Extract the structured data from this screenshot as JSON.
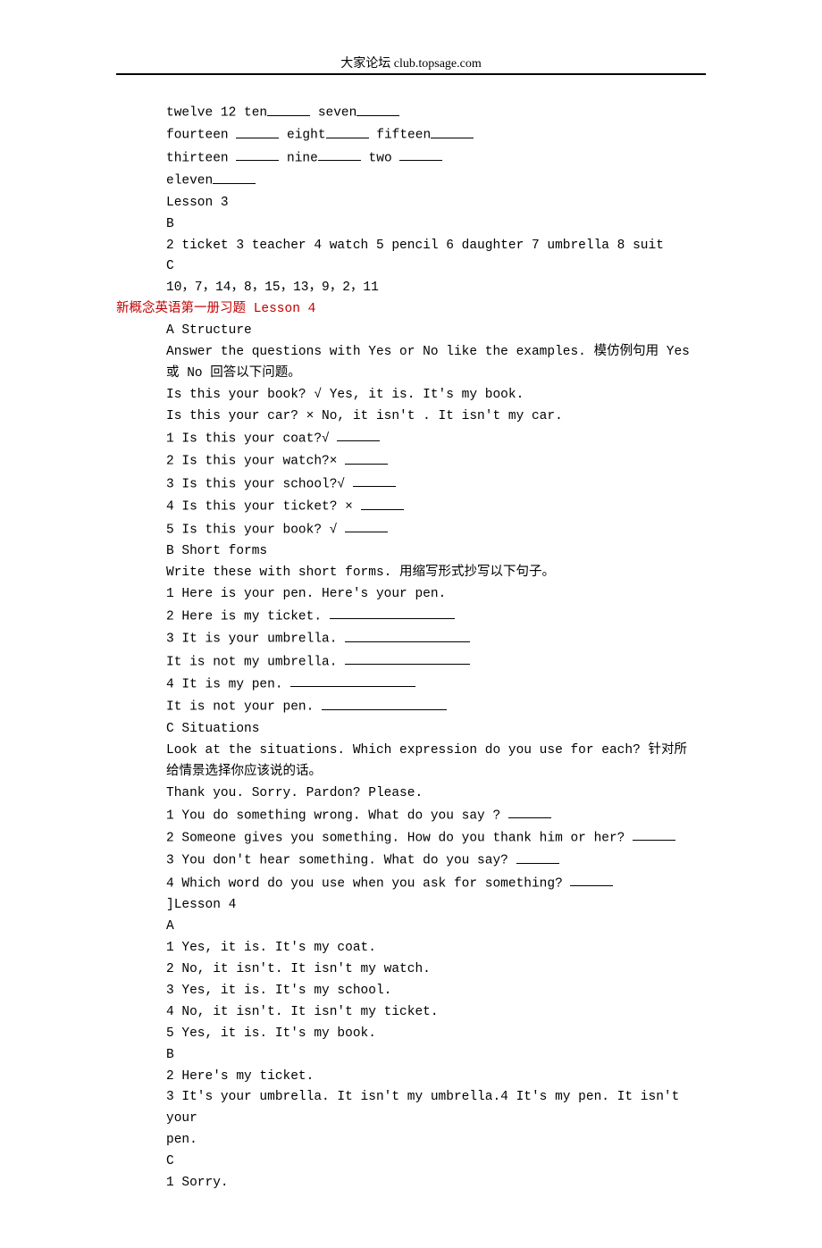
{
  "header": "大家论坛 club.topsage.com",
  "lines": [
    {
      "t": "twelve 12 ten______ seven______"
    },
    {
      "t": "fourteen ______ eight______ fifteen______"
    },
    {
      "t": "thirteen ______ nine______ two ______"
    },
    {
      "t": "eleven______"
    },
    {
      "t": "Lesson 3"
    },
    {
      "t": "B"
    },
    {
      "t": "2 ticket 3 teacher 4 watch 5 pencil 6 daughter 7 umbrella 8 suit"
    },
    {
      "t": "C"
    },
    {
      "t": "10，7，14，8，15，13，9，2，11"
    },
    {
      "t": "新概念英语第一册习题 Lesson 4",
      "h": true
    },
    {
      "t": "A Structure"
    },
    {
      "t": "Answer the questions with Yes or No like the examples. 模仿例句用 Yes"
    },
    {
      "t": "或 No 回答以下问题。"
    },
    {
      "t": "Is this your book? √ Yes, it is. It's my book."
    },
    {
      "t": "Is this your car? × No, it isn't . It isn't my car."
    },
    {
      "t": "1 Is this your coat?√ ______"
    },
    {
      "t": "2 Is this your watch?× ______"
    },
    {
      "t": "3 Is this your school?√ ______"
    },
    {
      "t": "4 Is this your ticket? × ______"
    },
    {
      "t": "5 Is this your book? √ ______"
    },
    {
      "t": "B Short forms"
    },
    {
      "t": "Write these with short forms. 用缩写形式抄写以下句子。"
    },
    {
      "t": "1 Here is your pen. Here's your pen."
    },
    {
      "t": "2 Here is my ticket. __________________"
    },
    {
      "t": "3 It is your umbrella. __________________"
    },
    {
      "t": "It is not my umbrella. __________________"
    },
    {
      "t": "4 It is my pen. __________________"
    },
    {
      "t": "It is not your pen. __________________"
    },
    {
      "t": "C Situations"
    },
    {
      "t": "Look at the situations. Which expression do you use for each? 针对所"
    },
    {
      "t": "给情景选择你应该说的话。"
    },
    {
      "t": "Thank you. Sorry. Pardon? Please."
    },
    {
      "t": "1 You do something wrong. What do you say ? ______"
    },
    {
      "t": "2 Someone gives you something. How do you thank him or her? ______"
    },
    {
      "t": "3 You don't hear something. What do you say? ______"
    },
    {
      "t": "4 Which word do you use when you ask for something? ______"
    },
    {
      "t": "]Lesson 4"
    },
    {
      "t": "A"
    },
    {
      "t": "1 Yes, it is. It's my coat."
    },
    {
      "t": "2 No, it isn't. It isn't my watch."
    },
    {
      "t": "3 Yes, it is. It's my school."
    },
    {
      "t": "4 No, it isn't. It isn't my ticket."
    },
    {
      "t": "5 Yes, it is. It's my book."
    },
    {
      "t": "B"
    },
    {
      "t": "2 Here's my ticket."
    },
    {
      "t": "3 It's your umbrella. It isn't my umbrella.4 It's my pen. It isn't your"
    },
    {
      "t": "pen."
    },
    {
      "t": "C"
    },
    {
      "t": "1 Sorry."
    }
  ]
}
